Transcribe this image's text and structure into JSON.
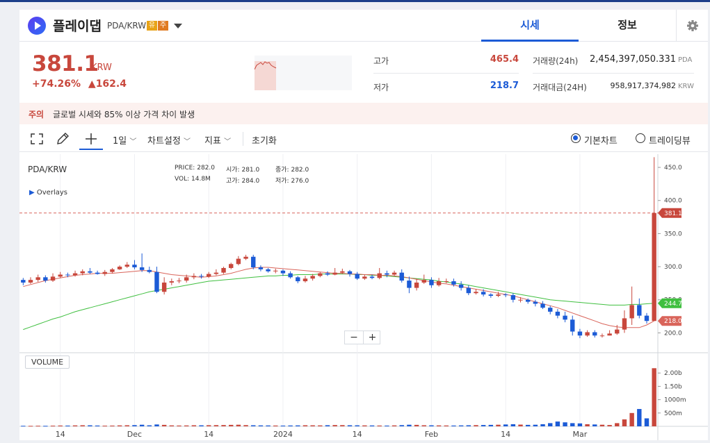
{
  "header": {
    "coin_name": "플레이댑",
    "pair": "PDA/KRW",
    "badges": [
      "유",
      "주"
    ],
    "tabs": [
      "시세",
      "정보"
    ]
  },
  "price": {
    "current": "381.1",
    "unit": "KRW",
    "change_pct": "+74.26%",
    "change_abs": "▲162.4",
    "high_label": "고가",
    "high": "465.4",
    "low_label": "저가",
    "low": "218.7",
    "volume_label": "거래량(24h)",
    "volume": "2,454,397,050.331",
    "volume_unit": "PDA",
    "value_label": "거래대금(24H)",
    "value": "958,917,374,982",
    "value_unit": "KRW"
  },
  "notice": {
    "label": "주의",
    "text": "글로벌 시세와 85% 이상 가격 차이 발생"
  },
  "toolbar": {
    "interval": "1일",
    "chart_settings": "차트설정",
    "indicators": "지표",
    "reset": "초기화",
    "basic_chart": "기본차트",
    "tradingview": "트레이딩뷰"
  },
  "legend": {
    "symbol": "PDA/KRW",
    "overlays": "Overlays",
    "price_label": "PRICE:",
    "price": "282.0",
    "open_label": "시가:",
    "open": "281.0",
    "close_label": "종가:",
    "close": "282.0",
    "vol_label": "VOL:",
    "vol": "14.8M",
    "high_label": "고가:",
    "high": "284.0",
    "low_label": "저가:",
    "low": "276.0"
  },
  "volume_label": "VOLUME",
  "zoom": {
    "minus": "−",
    "plus": "+"
  },
  "colors": {
    "up": "#c8473c",
    "down": "#1c5bd6",
    "ma_short": "#d9645a",
    "ma_long": "#3fbf3f",
    "accent": "#1c5bd6"
  },
  "chart_data": {
    "type": "candlestick",
    "price_axis_ticks": [
      "450.0",
      "400.0",
      "350.0",
      "300.0",
      "250.0",
      "200.0"
    ],
    "price_axis_values": [
      450,
      400,
      350,
      300,
      250,
      200
    ],
    "volume_axis_ticks": [
      "2.00b",
      "1.50b",
      "1000m",
      "500m"
    ],
    "volume_axis_values": [
      2000,
      1500,
      1000,
      500
    ],
    "x_ticks": [
      "14",
      "Dec",
      "14",
      "2024",
      "14",
      "Feb",
      "14",
      "Mar"
    ],
    "x_tick_indices": [
      5,
      15,
      25,
      35,
      45,
      55,
      65,
      75
    ],
    "current_price_label": "381.1",
    "current_price": 381.1,
    "ma_long_label": "244.7",
    "ma_long_last": 244.7,
    "ma_short_label": "218.0",
    "ma_short_last": 218.0,
    "candles": [
      [
        280,
        276,
        283,
        272
      ],
      [
        276,
        280,
        284,
        274
      ],
      [
        280,
        284,
        288,
        277
      ],
      [
        284,
        279,
        287,
        276
      ],
      [
        279,
        285,
        290,
        277
      ],
      [
        285,
        288,
        292,
        283
      ],
      [
        288,
        287,
        291,
        284
      ],
      [
        287,
        290,
        294,
        285
      ],
      [
        290,
        293,
        296,
        287
      ],
      [
        293,
        291,
        298,
        289
      ],
      [
        291,
        289,
        294,
        288
      ],
      [
        289,
        292,
        295,
        286
      ],
      [
        292,
        296,
        298,
        290
      ],
      [
        296,
        300,
        302,
        295
      ],
      [
        300,
        303,
        307,
        298
      ],
      [
        303,
        299,
        310,
        296
      ],
      [
        299,
        295,
        320,
        292
      ],
      [
        295,
        292,
        300,
        290
      ],
      [
        292,
        262,
        300,
        260
      ],
      [
        262,
        276,
        284,
        258
      ],
      [
        276,
        278,
        282,
        272
      ],
      [
        278,
        279,
        283,
        275
      ],
      [
        279,
        284,
        288,
        276
      ],
      [
        284,
        286,
        290,
        281
      ],
      [
        286,
        285,
        289,
        282
      ],
      [
        285,
        289,
        292,
        283
      ],
      [
        289,
        291,
        296,
        287
      ],
      [
        291,
        298,
        300,
        289
      ],
      [
        298,
        304,
        306,
        296
      ],
      [
        304,
        312,
        316,
        302
      ],
      [
        312,
        315,
        318,
        310
      ],
      [
        315,
        299,
        318,
        296
      ],
      [
        299,
        296,
        302,
        293
      ],
      [
        296,
        293,
        298,
        291
      ],
      [
        293,
        294,
        297,
        290
      ],
      [
        294,
        290,
        296,
        286
      ],
      [
        290,
        284,
        293,
        282
      ],
      [
        284,
        278,
        286,
        275
      ],
      [
        278,
        282,
        286,
        276
      ],
      [
        282,
        286,
        289,
        279
      ],
      [
        286,
        290,
        292,
        284
      ],
      [
        290,
        288,
        293,
        286
      ],
      [
        288,
        291,
        298,
        287
      ],
      [
        291,
        293,
        297,
        289
      ],
      [
        293,
        289,
        295,
        285
      ],
      [
        289,
        282,
        292,
        280
      ],
      [
        282,
        285,
        288,
        280
      ],
      [
        285,
        283,
        288,
        281
      ],
      [
        283,
        290,
        298,
        281
      ],
      [
        290,
        288,
        294,
        284
      ],
      [
        288,
        291,
        294,
        286
      ],
      [
        291,
        279,
        296,
        276
      ],
      [
        279,
        268,
        285,
        260
      ],
      [
        268,
        276,
        282,
        264
      ],
      [
        276,
        280,
        288,
        274
      ],
      [
        280,
        272,
        284,
        268
      ],
      [
        272,
        278,
        283,
        270
      ],
      [
        278,
        278,
        282,
        275
      ],
      [
        278,
        273,
        282,
        270
      ],
      [
        273,
        268,
        278,
        264
      ],
      [
        268,
        260,
        272,
        257
      ],
      [
        260,
        262,
        266,
        258
      ],
      [
        262,
        258,
        266,
        255
      ],
      [
        258,
        256,
        260,
        253
      ],
      [
        256,
        258,
        262,
        254
      ],
      [
        258,
        257,
        260,
        254
      ],
      [
        257,
        250,
        260,
        246
      ],
      [
        250,
        250,
        254,
        246
      ],
      [
        250,
        247,
        252,
        244
      ],
      [
        247,
        244,
        250,
        240
      ],
      [
        244,
        238,
        248,
        236
      ],
      [
        238,
        232,
        241,
        228
      ],
      [
        232,
        226,
        236,
        222
      ],
      [
        226,
        220,
        232,
        216
      ],
      [
        220,
        202,
        226,
        196
      ],
      [
        202,
        196,
        206,
        192
      ],
      [
        196,
        201,
        204,
        194
      ],
      [
        201,
        196,
        204,
        193
      ],
      [
        196,
        196,
        199,
        193
      ],
      [
        196,
        199,
        204,
        196
      ],
      [
        199,
        205,
        212,
        197
      ],
      [
        205,
        222,
        234,
        200
      ],
      [
        222,
        242,
        270,
        212
      ],
      [
        242,
        226,
        252,
        222
      ],
      [
        226,
        218,
        230,
        214
      ],
      [
        218,
        381.1,
        465.4,
        218
      ]
    ],
    "ma_long": [
      205,
      209,
      213,
      217,
      221,
      224,
      228,
      232,
      235,
      238,
      241,
      244,
      247,
      250,
      253,
      256,
      259,
      262,
      264,
      266,
      268,
      270,
      272,
      274,
      276,
      278,
      279,
      280,
      281,
      282,
      283,
      284,
      285,
      286,
      286,
      287,
      287,
      288,
      288,
      288,
      289,
      289,
      289,
      289,
      289,
      288,
      288,
      287,
      287,
      286,
      285,
      284,
      283,
      282,
      281,
      280,
      278,
      277,
      275,
      274,
      272,
      270,
      268,
      266,
      264,
      262,
      260,
      258,
      256,
      254,
      252,
      250,
      249,
      248,
      247,
      246,
      245,
      244,
      243,
      242,
      242,
      242,
      243,
      243,
      244,
      244.7
    ],
    "ma_short": [
      270,
      273,
      276,
      279,
      281,
      283,
      285,
      287,
      288,
      289,
      290,
      290,
      290,
      291,
      292,
      293,
      294,
      294,
      292,
      290,
      288,
      287,
      286,
      285,
      284,
      285,
      286,
      288,
      290,
      293,
      296,
      298,
      299,
      299,
      298,
      297,
      296,
      295,
      294,
      293,
      292,
      291,
      290,
      290,
      289,
      289,
      288,
      288,
      287,
      287,
      286,
      285,
      283,
      281,
      279,
      277,
      275,
      274,
      272,
      270,
      268,
      266,
      264,
      262,
      260,
      258,
      256,
      253,
      250,
      247,
      244,
      241,
      238,
      234,
      230,
      226,
      222,
      218,
      214,
      211,
      209,
      208,
      208,
      208,
      212,
      218.0
    ],
    "volume": [
      20,
      18,
      22,
      19,
      25,
      30,
      28,
      35,
      40,
      38,
      30,
      25,
      28,
      35,
      40,
      45,
      60,
      38,
      70,
      55,
      35,
      30,
      33,
      40,
      38,
      42,
      45,
      48,
      55,
      60,
      45,
      40,
      35,
      33,
      30,
      28,
      32,
      35,
      40,
      38,
      35,
      42,
      48,
      45,
      40,
      38,
      35,
      33,
      30,
      28,
      35,
      45,
      60,
      55,
      40,
      38,
      35,
      32,
      30,
      35,
      40,
      45,
      50,
      55,
      60,
      70,
      80,
      65,
      55,
      60,
      80,
      120,
      180,
      150,
      120,
      110,
      80,
      70,
      60,
      50,
      120,
      260,
      500,
      650,
      300,
      2180
    ]
  }
}
